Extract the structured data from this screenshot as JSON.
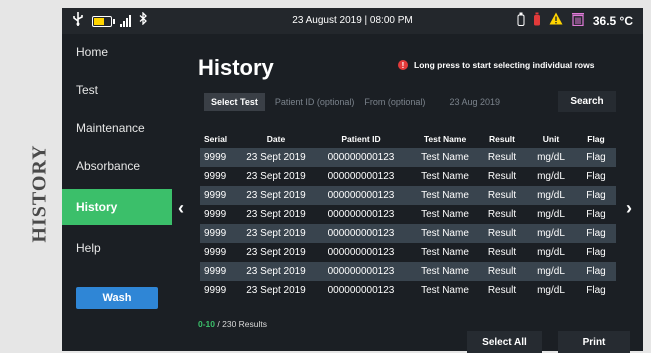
{
  "caption": "HISTORY",
  "status_bar": {
    "datetime": "23 August 2019 | 08:00 PM",
    "temperature": "36.5 °C",
    "battery_level": 0.6,
    "icons": [
      "usb-icon",
      "battery-icon",
      "signal-icon",
      "bluetooth-icon",
      "bottle-icon",
      "bottle-red-icon",
      "warning-icon",
      "trash-icon"
    ],
    "colors": {
      "battery": "#ffd400",
      "warning": "#ffd400",
      "bottle_red": "#e23a3a"
    }
  },
  "sidebar": {
    "items": [
      {
        "label": "Home"
      },
      {
        "label": "Test"
      },
      {
        "label": "Maintenance"
      },
      {
        "label": "Absorbance"
      },
      {
        "label": "History",
        "active": true
      },
      {
        "label": "Help"
      }
    ],
    "wash_label": "Wash"
  },
  "main": {
    "title": "History",
    "hint": "Long press to start selecting individual rows",
    "hint_badge": "!",
    "filters": {
      "select_test": "Select Test",
      "patient_id_placeholder": "Patient ID (optional)",
      "from_placeholder": "From (optional)",
      "to_date": "23 Aug 2019"
    },
    "search_label": "Search",
    "table": {
      "headers": [
        "Serial",
        "Date",
        "Patient ID",
        "Test Name",
        "Result",
        "Unit",
        "Flag"
      ],
      "rows": [
        [
          "9999",
          "23 Sept 2019",
          "000000000123",
          "Test Name",
          "Result",
          "mg/dL",
          "Flag"
        ],
        [
          "9999",
          "23 Sept 2019",
          "000000000123",
          "Test Name",
          "Result",
          "mg/dL",
          "Flag"
        ],
        [
          "9999",
          "23 Sept 2019",
          "000000000123",
          "Test Name",
          "Result",
          "mg/dL",
          "Flag"
        ],
        [
          "9999",
          "23 Sept 2019",
          "000000000123",
          "Test Name",
          "Result",
          "mg/dL",
          "Flag"
        ],
        [
          "9999",
          "23 Sept 2019",
          "000000000123",
          "Test Name",
          "Result",
          "mg/dL",
          "Flag"
        ],
        [
          "9999",
          "23 Sept 2019",
          "000000000123",
          "Test Name",
          "Result",
          "mg/dL",
          "Flag"
        ],
        [
          "9999",
          "23 Sept 2019",
          "000000000123",
          "Test Name",
          "Result",
          "mg/dL",
          "Flag"
        ],
        [
          "9999",
          "23 Sept 2019",
          "000000000123",
          "Test Name",
          "Result",
          "mg/dL",
          "Flag"
        ]
      ]
    },
    "results_range": "0-10",
    "results_total": "/ 230 Results",
    "select_all_label": "Select All",
    "print_label": "Print",
    "accent_color": "#3bbf6a",
    "row_alt_color": "#39444e"
  }
}
